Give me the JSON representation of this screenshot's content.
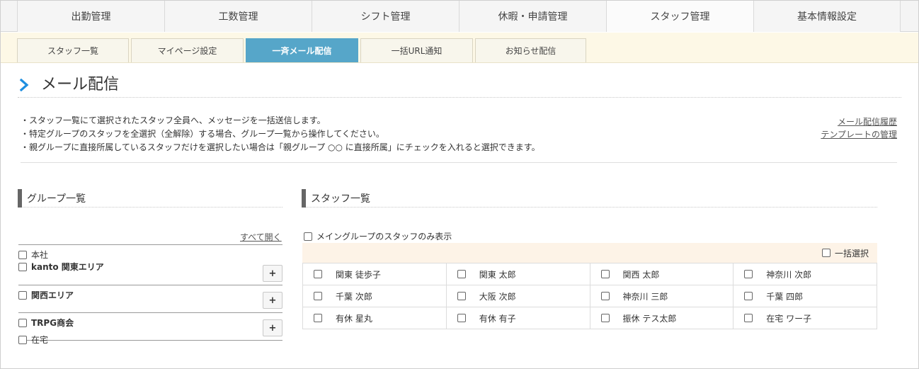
{
  "main_tabs": [
    {
      "label": "出勤管理"
    },
    {
      "label": "工数管理"
    },
    {
      "label": "シフト管理"
    },
    {
      "label": "休暇・申請管理"
    },
    {
      "label": "スタッフ管理",
      "active": true
    },
    {
      "label": "基本情報設定"
    }
  ],
  "sub_tabs": [
    {
      "label": "スタッフ一覧"
    },
    {
      "label": "マイページ設定"
    },
    {
      "label": "一斉メール配信",
      "active": true
    },
    {
      "label": "一括URL通知"
    },
    {
      "label": "お知らせ配信"
    }
  ],
  "page": {
    "title": "メール配信"
  },
  "info": {
    "lines": [
      "・スタッフ一覧にて選択されたスタッフ全員へ、メッセージを一括送信します。",
      "・特定グループのスタッフを全選択（全解除）する場合、グループ一覧から操作してください。",
      "・親グループに直接所属しているスタッフだけを選択したい場合は「親グループ ○○ に直接所属」にチェックを入れると選択できます。"
    ],
    "links": [
      "メール配信履歴",
      "テンプレートの管理"
    ]
  },
  "groups": {
    "heading": "グループ一覧",
    "open_all": "すべて開く",
    "items": [
      {
        "first": "本社",
        "second": "kanto 関東エリア",
        "has_plus": true
      },
      {
        "first": "関西エリア",
        "has_plus": true
      },
      {
        "first": "TRPG商会",
        "has_plus": true
      }
    ],
    "tail": "在宅",
    "plus_label": "+"
  },
  "staff": {
    "heading": "スタッフ一覧",
    "main_only_label": "メイングループのスタッフのみ表示",
    "select_all_label": "一括選択",
    "rows": [
      [
        "関東 徒歩子",
        "関東 太郎",
        "関西 太郎",
        "神奈川 次郎"
      ],
      [
        "千葉 次郎",
        "大阪 次郎",
        "神奈川 三郎",
        "千葉 四郎"
      ],
      [
        "有休 星丸",
        "有休 有子",
        "振休 テス太郎",
        "在宅 ワー子"
      ]
    ]
  },
  "colors": {
    "accent": "#56a6c9",
    "chevron": "#1f8fe0",
    "subnav_bg": "#fdf8e6",
    "bulk_bg": "#fdf3e7"
  }
}
